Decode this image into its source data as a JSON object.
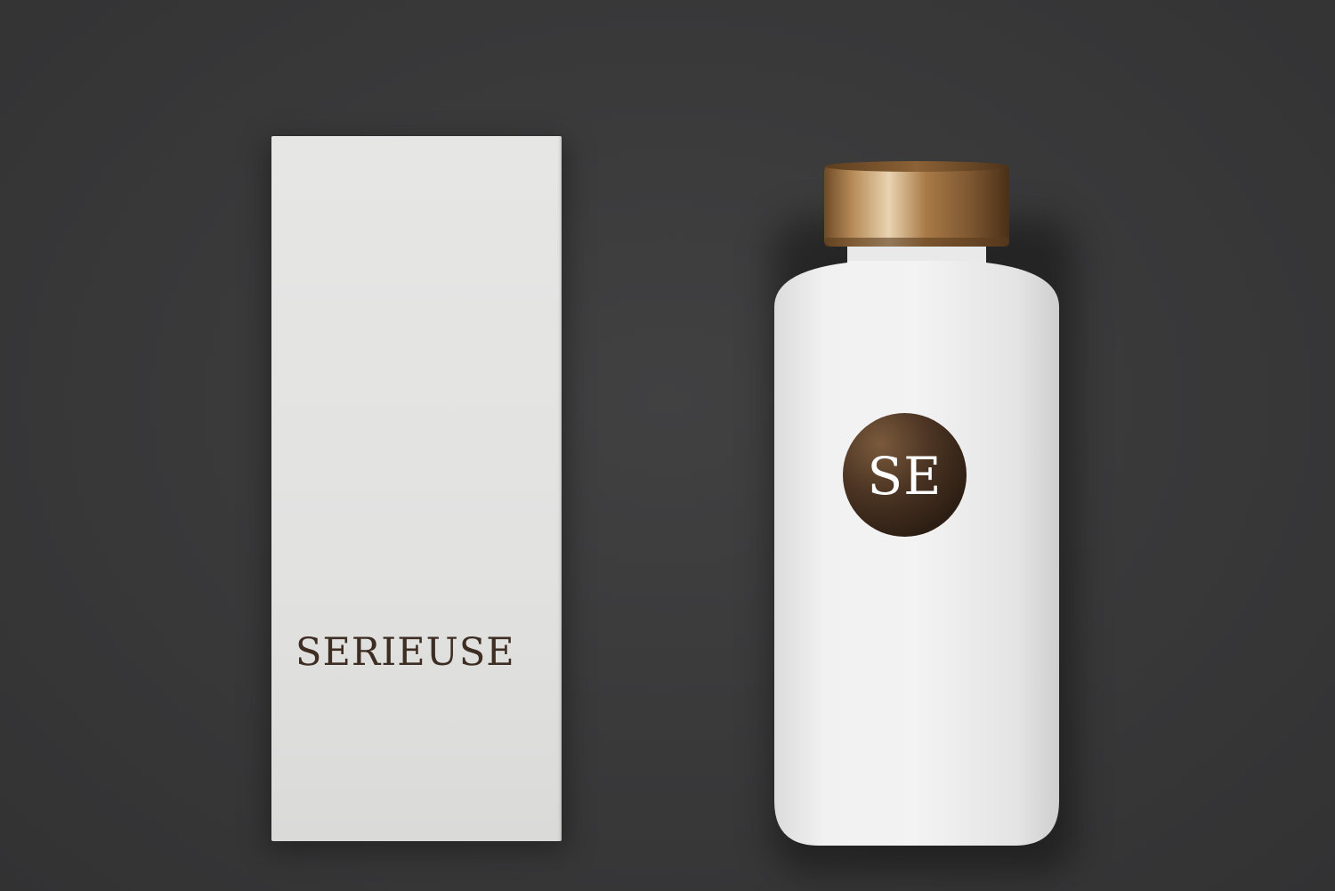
{
  "scene": {
    "background_color": "#3a3a3b",
    "box_color": "#e3e3e2",
    "bottle_color": "#eeeeee",
    "cap_color": "#b08450",
    "accent_color": "#3d2d22"
  },
  "box": {
    "brand_text": "SERIEUSE"
  },
  "bottle": {
    "logo_text": "SE",
    "logo_icon": "monogram-circle-icon"
  }
}
